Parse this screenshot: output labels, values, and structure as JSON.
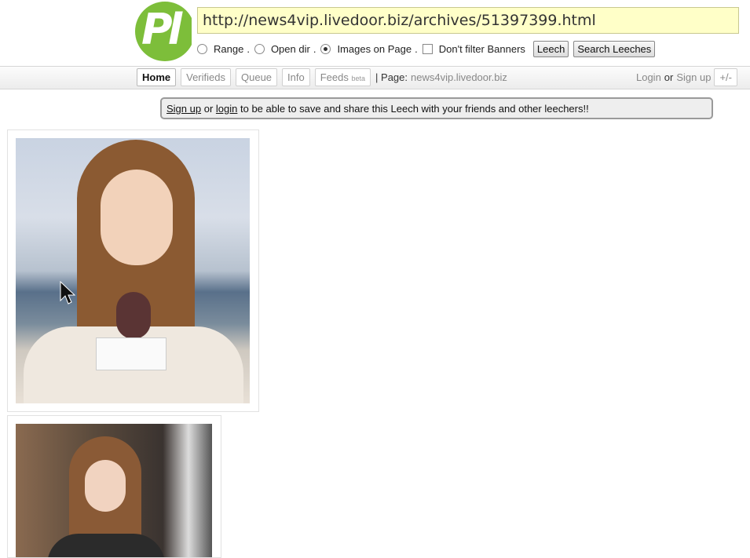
{
  "header": {
    "logo_text": "Pl",
    "url": "http://news4vip.livedoor.biz/archives/51397399.html",
    "options": {
      "range_label": "Range",
      "open_dir_label": "Open dir",
      "images_on_page_label": "Images on Page",
      "dont_filter_label": "Don't filter Banners",
      "sep": "."
    },
    "buttons": {
      "leech": "Leech",
      "search_leeches": "Search Leeches"
    }
  },
  "nav": {
    "tabs": {
      "home": "Home",
      "verifieds": "Verifieds",
      "queue": "Queue",
      "info": "Info",
      "feeds": "Feeds",
      "feeds_badge": "beta"
    },
    "page_label": "| Page:",
    "page_host": "news4vip.livedoor.biz",
    "login": "Login",
    "or": "or",
    "signup": "Sign up",
    "plus_minus": "+/-"
  },
  "notice": {
    "signup": "Sign up",
    "or": "or",
    "login": "login",
    "rest": "to be able to save and share this Leech with your friends and other leechers!!"
  },
  "colors": {
    "url_bg": "#ffffc8",
    "logo_green": "#7dbe3a"
  }
}
